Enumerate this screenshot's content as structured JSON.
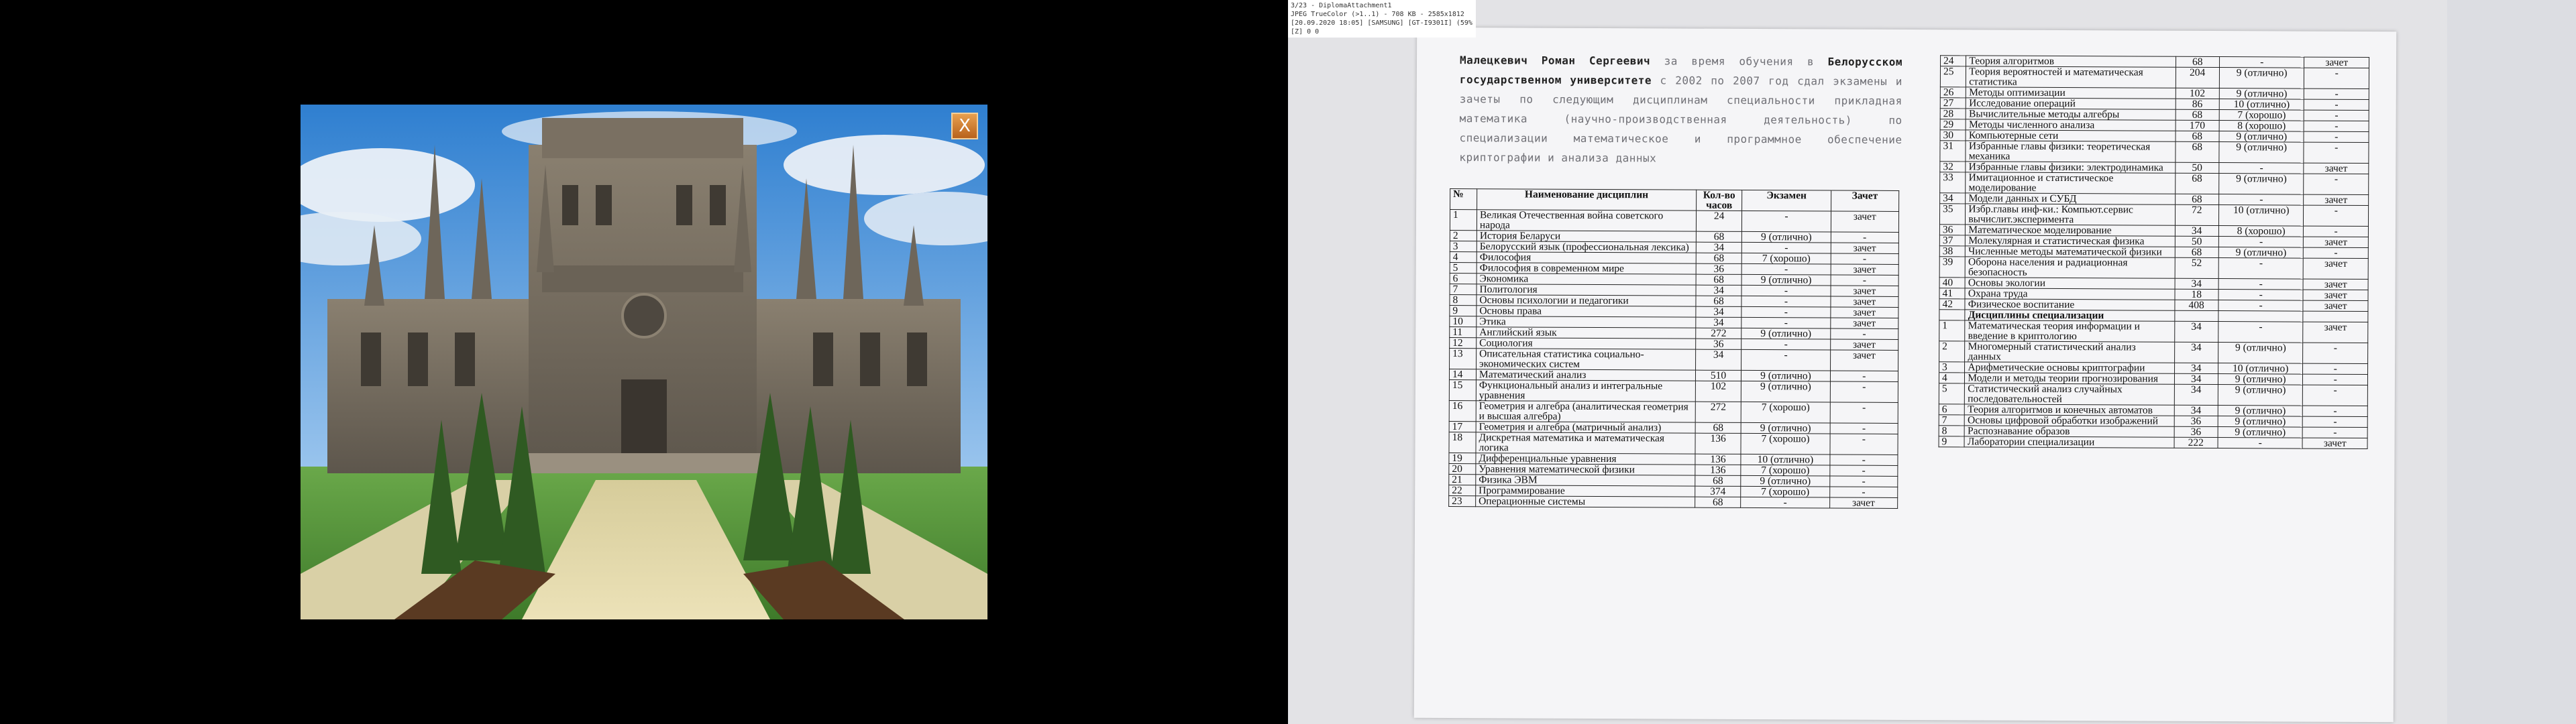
{
  "viewer": {
    "info_lines": [
      "3/23 - DiplomaAttachment1",
      "JPEG TrueColor (>1..1) - 708 KB - 2585x1812",
      "[20.09.2020 18:05] [SAMSUNG] [GT-I9301I] (59%)",
      "[Z] 0 0"
    ]
  },
  "game": {
    "close_label": "X"
  },
  "document": {
    "intro_bold": "Малецкевич Роман Сергеевич",
    "intro_text1": " за время обучения в ",
    "intro_bold2": "Белорусском государственном университете",
    "intro_text2": " с 2002 по 2007 год сдал экзамены и зачеты по следующим дисциплинам специальности прикладная математика (научно-производственная деятельность) по специализации математическое и программное обеспечение криптографии и анализа данных",
    "headers": [
      "№",
      "Наименование дисциплин",
      "Кол-во часов",
      "Экзамен",
      "Зачет"
    ],
    "left_rows": [
      [
        "1",
        "Великая Отечественная война советского народа",
        "24",
        "-",
        "зачет"
      ],
      [
        "2",
        "История Беларуси",
        "68",
        "9 (отлично)",
        "-"
      ],
      [
        "3",
        "Белорусский язык (профессиональная лексика)",
        "34",
        "-",
        "зачет"
      ],
      [
        "4",
        "Философия",
        "68",
        "7 (хорошо)",
        "-"
      ],
      [
        "5",
        "Философия в современном мире",
        "36",
        "-",
        "зачет"
      ],
      [
        "6",
        "Экономика",
        "68",
        "9 (отлично)",
        "-"
      ],
      [
        "7",
        "Политология",
        "34",
        "-",
        "зачет"
      ],
      [
        "8",
        "Основы психологии и педагогики",
        "68",
        "-",
        "зачет"
      ],
      [
        "9",
        "Основы права",
        "34",
        "-",
        "зачет"
      ],
      [
        "10",
        "Этика",
        "34",
        "-",
        "зачет"
      ],
      [
        "11",
        "Английский язык",
        "272",
        "9 (отлично)",
        "-"
      ],
      [
        "12",
        "Социология",
        "36",
        "-",
        "зачет"
      ],
      [
        "13",
        "Описательная статистика социально-экономических систем",
        "34",
        "-",
        "зачет"
      ],
      [
        "14",
        "Математический анализ",
        "510",
        "9 (отлично)",
        "-"
      ],
      [
        "15",
        "Функциональный анализ и интегральные уравнения",
        "102",
        "9 (отлично)",
        "-"
      ],
      [
        "16",
        "Геометрия и алгебра (аналитическая геометрия и высшая алгебра)",
        "272",
        "7 (хорошо)",
        "-"
      ],
      [
        "17",
        "Геометрия и алгебра (матричный анализ)",
        "68",
        "9 (отлично)",
        "-"
      ],
      [
        "18",
        "Дискретная математика и математическая логика",
        "136",
        "7 (хорошо)",
        "-"
      ],
      [
        "19",
        "Дифференциальные уравнения",
        "136",
        "10 (отлично)",
        "-"
      ],
      [
        "20",
        "Уравнения математической физики",
        "136",
        "7 (хорошо)",
        "-"
      ],
      [
        "21",
        "Физика ЭВМ",
        "68",
        "9 (отлично)",
        "-"
      ],
      [
        "22",
        "Программирование",
        "374",
        "7 (хорошо)",
        "-"
      ],
      [
        "23",
        "Операционные системы",
        "68",
        "-",
        "зачет"
      ]
    ],
    "right_rows": [
      [
        "24",
        "Теория алгоритмов",
        "68",
        "-",
        "зачет"
      ],
      [
        "25",
        "Теория вероятностей и математическая статистика",
        "204",
        "9 (отлично)",
        "-"
      ],
      [
        "26",
        "Методы оптимизации",
        "102",
        "9 (отлично)",
        "-"
      ],
      [
        "27",
        "Исследование операций",
        "86",
        "10 (отлично)",
        "-"
      ],
      [
        "28",
        "Вычислительные методы алгебры",
        "68",
        "7 (хорошо)",
        "-"
      ],
      [
        "29",
        "Методы численного анализа",
        "170",
        "8 (хорошо)",
        "-"
      ],
      [
        "30",
        "Компьютерные сети",
        "68",
        "9 (отлично)",
        "-"
      ],
      [
        "31",
        "Избранные главы физики: теоретическая механика",
        "68",
        "9 (отлично)",
        "-"
      ],
      [
        "32",
        "Избранные главы физики: электродинамика",
        "50",
        "-",
        "зачет"
      ],
      [
        "33",
        "Имитационное и статистическое моделирование",
        "68",
        "9 (отлично)",
        "-"
      ],
      [
        "34",
        "Модели данных и СУБД",
        "68",
        "-",
        "зачет"
      ],
      [
        "35",
        "Избр.главы инф-ки.: Компьют.сервис вычислит.эксперимента",
        "72",
        "10 (отлично)",
        "-"
      ],
      [
        "36",
        "Математическое моделирование",
        "34",
        "8 (хорошо)",
        "-"
      ],
      [
        "37",
        "Молекулярная и статистическая физика",
        "50",
        "-",
        "зачет"
      ],
      [
        "38",
        "Численные методы математической физики",
        "68",
        "9 (отлично)",
        "-"
      ],
      [
        "39",
        "Оборона населения и радиационная безопасность",
        "52",
        "-",
        "зачет"
      ],
      [
        "40",
        "Основы экологии",
        "34",
        "-",
        "зачет"
      ],
      [
        "41",
        "Охрана труда",
        "18",
        "-",
        "зачет"
      ],
      [
        "42",
        "Физическое воспитание",
        "408",
        "-",
        "зачет"
      ],
      [
        "",
        "Дисциплины специализации",
        "",
        "",
        ""
      ],
      [
        "1",
        "Математическая теория информации и введение в криптологию",
        "34",
        "-",
        "зачет"
      ],
      [
        "2",
        "Многомерный статистический анализ данных",
        "34",
        "9 (отлично)",
        "-"
      ],
      [
        "3",
        "Арифметические основы криптографии",
        "34",
        "10 (отлично)",
        "-"
      ],
      [
        "4",
        "Модели и методы теории прогнозирования",
        "34",
        "9 (отлично)",
        "-"
      ],
      [
        "5",
        "Статистический анализ случайных последовательностей",
        "34",
        "9 (отлично)",
        "-"
      ],
      [
        "6",
        "Теория алгоритмов и конечных автоматов",
        "34",
        "9 (отлично)",
        "-"
      ],
      [
        "7",
        "Основы цифровой обработки изображений",
        "36",
        "9 (отлично)",
        "-"
      ],
      [
        "8",
        "Распознавание образов",
        "36",
        "9 (отлично)",
        "-"
      ],
      [
        "9",
        "Лаборатории специализации",
        "222",
        "-",
        "зачет"
      ]
    ]
  }
}
